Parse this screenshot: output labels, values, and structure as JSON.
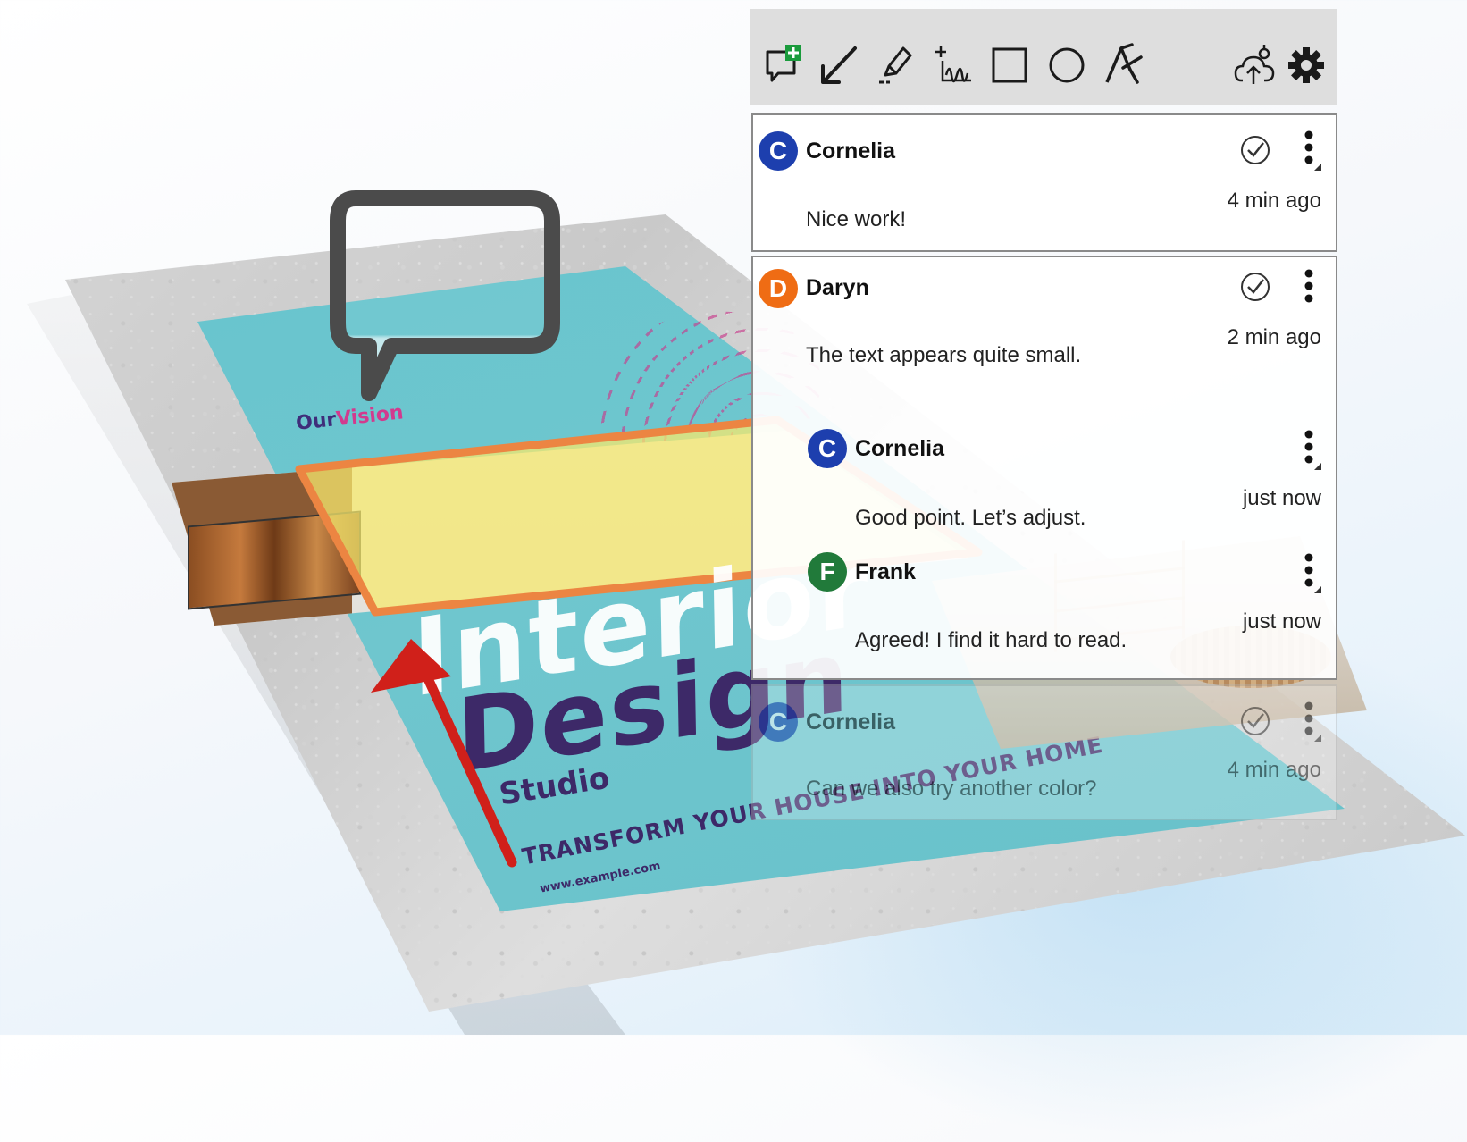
{
  "toolbar": {
    "buttons": [
      {
        "name": "add-comment-icon",
        "color": "#1a9b3c"
      },
      {
        "name": "arrow-icon"
      },
      {
        "name": "highlighter-icon"
      },
      {
        "name": "freehand-icon"
      },
      {
        "name": "rectangle-icon"
      },
      {
        "name": "ellipse-icon"
      },
      {
        "name": "text-style-icon"
      },
      {
        "name": "cloud-upload-icon"
      },
      {
        "name": "gear-icon"
      }
    ]
  },
  "comments": [
    {
      "author": "Cornelia",
      "initial": "C",
      "avatar_color": "#1d3fae",
      "time": "4 min ago",
      "text": "Nice work!"
    },
    {
      "author": "Daryn",
      "initial": "D",
      "avatar_color": "#ef6c14",
      "time": "2 min ago",
      "text": "The text appears quite small.",
      "replies": [
        {
          "author": "Cornelia",
          "initial": "C",
          "avatar_color": "#1d3fae",
          "time": "just now",
          "text": "Good point. Let’s adjust."
        },
        {
          "author": "Frank",
          "initial": "F",
          "avatar_color": "#217a3a",
          "time": "just now",
          "text": "Agreed! I find it hard to read."
        }
      ]
    },
    {
      "author": "Cornelia",
      "initial": "C",
      "avatar_color": "#1d3fae",
      "time": "4 min ago",
      "text": "Can we also try another color?"
    }
  ],
  "poster": {
    "our": "Our",
    "vision": "Vision",
    "title1": "Interior",
    "title2": "Design",
    "subtitle": "Studio",
    "tagline": "TRANSFORM YOUR HOUSE INTO YOUR HOME",
    "url": "www.example.com"
  },
  "colors": {
    "teal": "#66c0c9",
    "purple": "#3d2968",
    "magenta": "#d23a8e",
    "highlight_yellow": "#f5e86e",
    "highlight_orange": "#ec8542",
    "arrow_red": "#d0201a"
  }
}
